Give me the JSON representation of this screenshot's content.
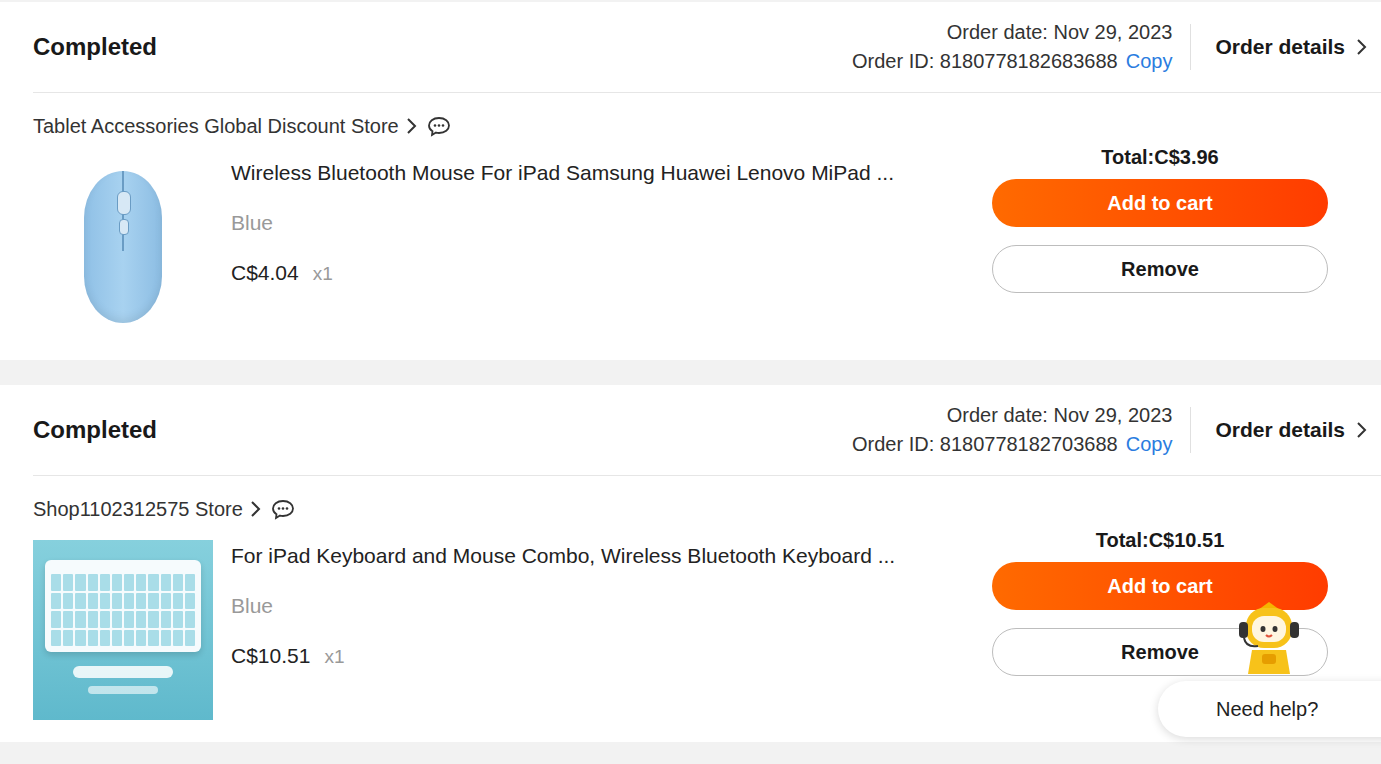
{
  "orders": [
    {
      "status": "Completed",
      "order_date": "Order date: Nov 29, 2023",
      "order_id": "Order ID: 8180778182683688",
      "copy": "Copy",
      "details": "Order details",
      "store": "Tablet Accessories Global Discount Store",
      "title": "Wireless Bluetooth Mouse For iPad Samsung Huawei Lenovo MiPad ...",
      "variant": "Blue",
      "price": "C$4.04",
      "qty": "x1",
      "total": "Total:C$3.96",
      "kind": "mouse",
      "buttons": [
        "Add to cart",
        "Remove"
      ]
    },
    {
      "status": "Completed",
      "order_date": "Order date: Nov 29, 2023",
      "order_id": "Order ID: 8180778182703688",
      "copy": "Copy",
      "details": "Order details",
      "store": "Shop1102312575 Store",
      "title": "For iPad Keyboard and Mouse Combo, Wireless Bluetooth Keyboard ...",
      "variant": "Blue",
      "price": "C$10.51",
      "qty": "x1",
      "total": "Total:C$10.51",
      "kind": "keyboard",
      "buttons": [
        "Add to cart",
        "Remove"
      ]
    }
  ],
  "help": {
    "label": "Need help?"
  }
}
